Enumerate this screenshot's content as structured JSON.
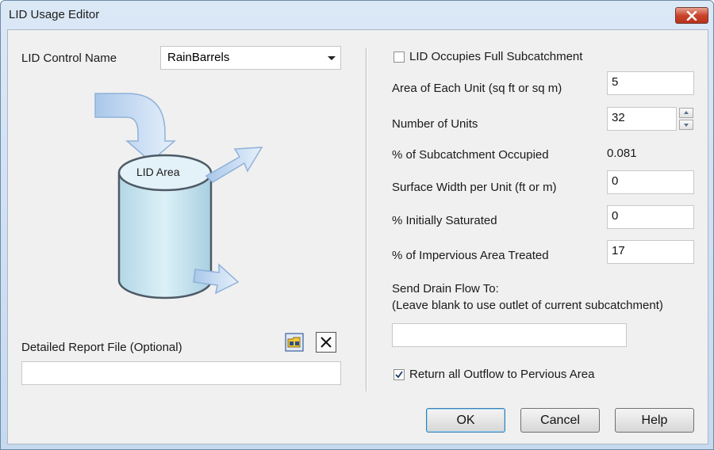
{
  "window": {
    "title": "LID Usage Editor"
  },
  "left": {
    "lid_control_label": "LID Control Name",
    "lid_control_value": "RainBarrels",
    "diagram_label": "LID Area",
    "report_label": "Detailed Report File (Optional)",
    "report_value": ""
  },
  "right": {
    "full_subcatchment_label": "LID Occupies Full Subcatchment",
    "full_subcatchment_checked": false,
    "area_label": "Area of Each Unit (sq ft or sq m)",
    "area_value": "5",
    "units_label": "Number of Units",
    "units_value": "32",
    "occupied_label": "% of Subcatchment Occupied",
    "occupied_value": "0.081",
    "width_label": "Surface Width per Unit (ft or m)",
    "width_value": "0",
    "saturated_label": "% Initially Saturated",
    "saturated_value": "0",
    "impervious_label": "% of Impervious Area Treated",
    "impervious_value": "17",
    "drain_label": "Send Drain Flow To:",
    "drain_hint": "(Leave blank to use outlet of current subcatchment)",
    "drain_value": "",
    "return_outflow_label": "Return all Outflow to Pervious Area",
    "return_outflow_checked": true
  },
  "buttons": {
    "ok": "OK",
    "cancel": "Cancel",
    "help": "Help"
  },
  "icons": {
    "close": "close-icon",
    "browse": "browse-folder-icon",
    "clear": "clear-x-icon",
    "checkmark": "checkmark-icon"
  }
}
